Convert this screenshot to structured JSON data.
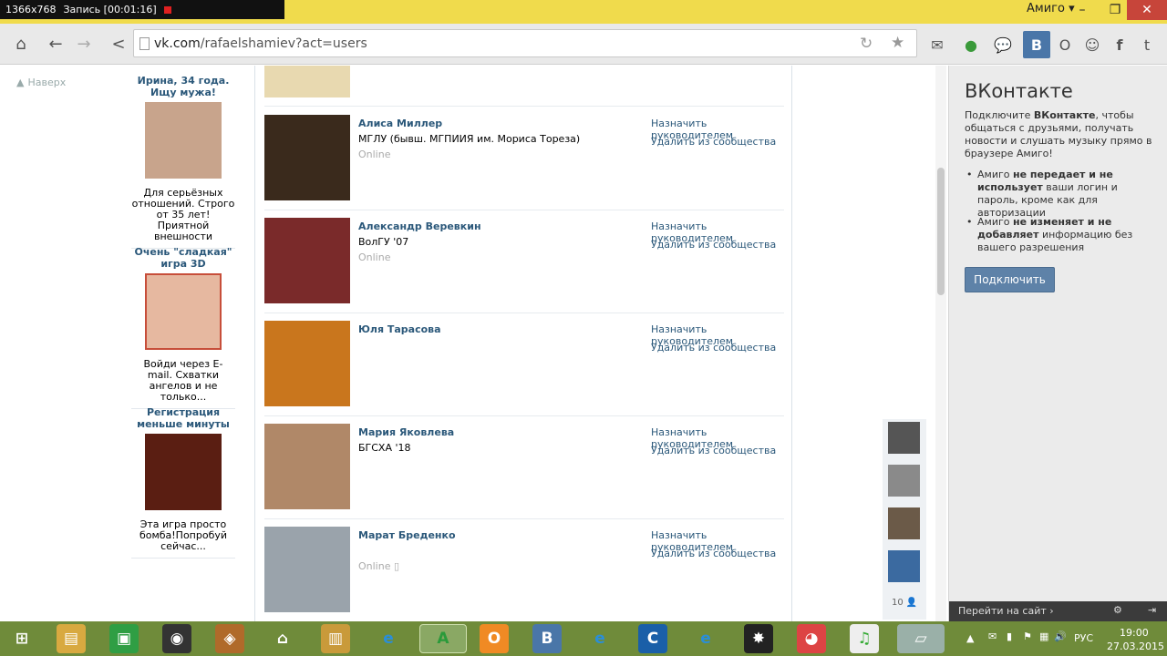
{
  "recorder": {
    "resolution": "1366x768",
    "status": "Запись [00:01:16]"
  },
  "window": {
    "profile_name": "Амиго"
  },
  "toolbar": {
    "url_host": "vk.com",
    "url_path": "/rafaelshamiev?act=users"
  },
  "nav": {
    "back_to_top": "Наверх"
  },
  "ads": [
    {
      "title": "Ирина, 34 года. Ищу мужа!",
      "text": "Для серьёзных отношений. Строго от 35 лет! Приятной внешности",
      "img_color": "#c8a48c"
    },
    {
      "title": "Очень \"сладкая\" игра 3D",
      "text": "Войди через E-mail. Схватки ангелов и не только...",
      "img_color": "#e6b8a0"
    },
    {
      "title": "Регистрация меньше минуты",
      "text": "Эта игра просто бомба!Попробуй сейчас...",
      "img_color": "#5a1e12"
    }
  ],
  "members": [
    {
      "name": "Алиса Миллер",
      "info": "МГЛУ (бывш. МГПИИЯ им. Мориса Тореза)",
      "status": "Online",
      "photo_color": "#3a2a1c"
    },
    {
      "name": "Александр Веревкин",
      "info": "ВолГУ '07",
      "status": "Online",
      "photo_color": "#7a2a2a"
    },
    {
      "name": "Юля Тарасова",
      "info": "",
      "status": "",
      "photo_color": "#c9761d"
    },
    {
      "name": "Мария Яковлева",
      "info": "БГСХА '18",
      "status": "",
      "photo_color": "#b08868"
    },
    {
      "name": "Марат Бреденко",
      "info": "",
      "status": "Online",
      "photo_color": "#9aa3ab"
    }
  ],
  "member_actions": {
    "make_manager": "Назначить руководителем",
    "remove": "Удалить из сообщества"
  },
  "side_avatars": {
    "count": "10"
  },
  "sidebar": {
    "title": "ВКонтакте",
    "text_prefix": "Подключите ",
    "text_bold": "ВКонтакте",
    "text_suffix": ", чтобы общаться с друзьями, получать новости и слушать музыку прямо в браузере Амиго!",
    "bullet1_prefix": "Амиго ",
    "bullet1_bold": "не передает и не использует",
    "bullet1_suffix": " ваши логин и пароль, кроме как для авторизации",
    "bullet2_prefix": "Амиго ",
    "bullet2_bold": "не изменяет и не добавляет",
    "bullet2_suffix": " информацию без вашего разрешения",
    "connect_button": "Подключить",
    "go_to_site": "Перейти на сайт ›"
  },
  "taskbar": {
    "lang": "РУС",
    "time": "19:00",
    "date": "27.03.2015"
  }
}
